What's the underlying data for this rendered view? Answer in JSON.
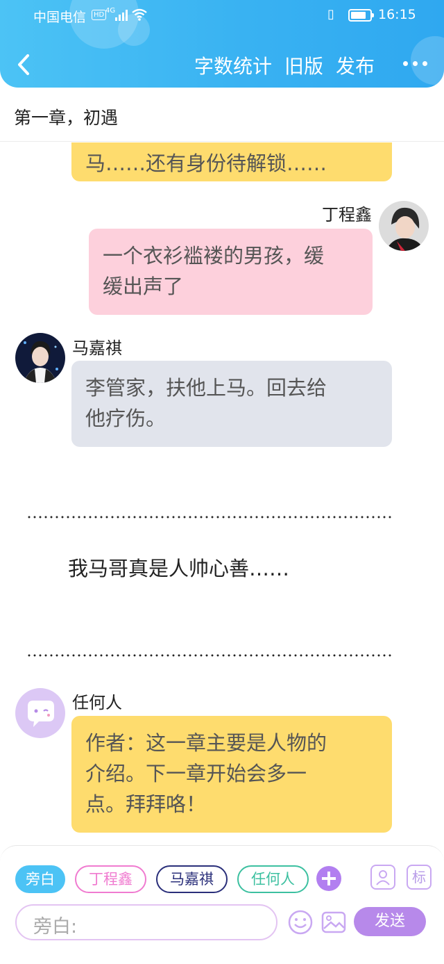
{
  "status_bar": {
    "carrier": "中国电信",
    "hd": "HD",
    "network": "4G",
    "time": "16:15",
    "battery_percent": 80
  },
  "header": {
    "buttons": [
      "字数统计",
      "旧版",
      "发布"
    ],
    "back_icon": "chevron-left-icon",
    "more_icon": "more-dots-icon"
  },
  "chapter_title": "第一章，初遇",
  "messages": [
    {
      "speaker": "",
      "text_lines": [
        "马……还有身份待解锁……"
      ],
      "color": "#fedc6e"
    },
    {
      "speaker": "丁程鑫",
      "text_lines": [
        "一个衣衫褴褛的男孩，缓",
        "缓出声了"
      ],
      "color": "#fdd0dc"
    },
    {
      "speaker": "马嘉祺",
      "text_lines": [
        "李管家，扶他上马。回去给",
        "他疗伤。"
      ],
      "color": "#e1e4ec"
    },
    {
      "narration": "我马哥真是人帅心善……"
    },
    {
      "speaker": "任何人",
      "text_lines": [
        "作者：这一章主要是人物的",
        "介绍。下一章开始会多一",
        "点。拜拜咯！"
      ],
      "color": "#fedc6e"
    }
  ],
  "role_chips": [
    {
      "label": "旁白",
      "color": "#4cc3f5",
      "active": true
    },
    {
      "label": "丁程鑫",
      "color": "#f07bd0",
      "active": false
    },
    {
      "label": "马嘉祺",
      "color": "#2a2f7a",
      "active": false
    },
    {
      "label": "任何人",
      "color": "#3cc0a0",
      "active": false
    }
  ],
  "tools": {
    "add_role_icon": "plus-icon",
    "contacts_icon": "contact-card-icon",
    "mark_label": "标"
  },
  "composer": {
    "placeholder": "旁白:",
    "emoji_icon": "smiley-icon",
    "image_icon": "image-icon",
    "send_label": "发送"
  }
}
